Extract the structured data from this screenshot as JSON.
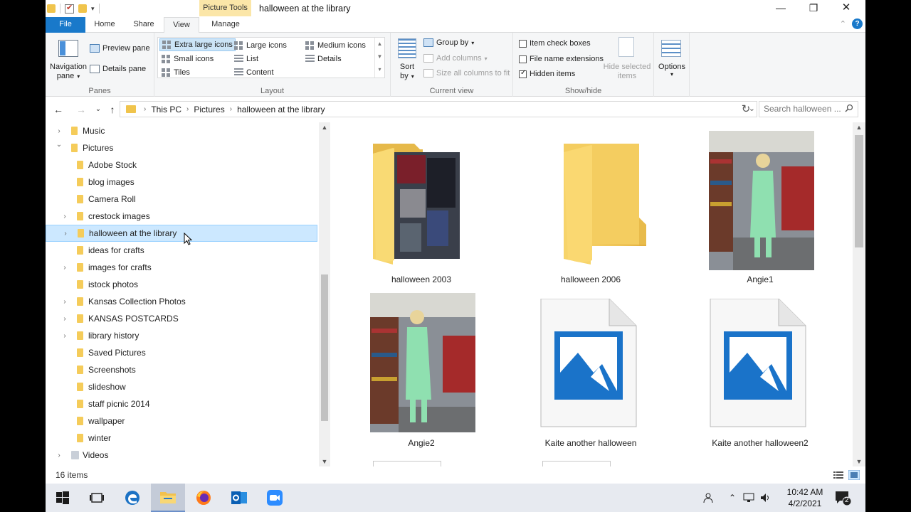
{
  "window": {
    "picture_tools": "Picture Tools",
    "title": "halloween at the library",
    "controls": {
      "minimize": "—",
      "maximize": "❐",
      "close": "✕"
    }
  },
  "tabs": {
    "file": "File",
    "home": "Home",
    "share": "Share",
    "view": "View",
    "manage": "Manage"
  },
  "ribbon": {
    "panes": {
      "label": "Panes",
      "navigation_pane": "Navigation",
      "navigation_pane2": "pane",
      "preview_pane": "Preview pane",
      "details_pane": "Details pane"
    },
    "layout": {
      "label": "Layout",
      "extra_large_icons": "Extra large icons",
      "large_icons": "Large icons",
      "medium_icons": "Medium icons",
      "small_icons": "Small icons",
      "list": "List",
      "details": "Details",
      "tiles": "Tiles",
      "content": "Content"
    },
    "current_view": {
      "label": "Current view",
      "sort_by": "Sort",
      "sort_by2": "by",
      "group_by": "Group by",
      "add_columns": "Add columns",
      "size_all_columns": "Size all columns to fit"
    },
    "show_hide": {
      "label": "Show/hide",
      "item_check_boxes": "Item check boxes",
      "file_name_extensions": "File name extensions",
      "hidden_items": "Hidden items",
      "hide_selected_items": "Hide selected",
      "hide_selected_items2": "items",
      "item_check_boxes_checked": false,
      "file_name_extensions_checked": false,
      "hidden_items_checked": true
    },
    "options": "Options"
  },
  "address": {
    "crumbs": [
      "This PC",
      "Pictures",
      "halloween at the library"
    ],
    "search_placeholder": "Search halloween ..."
  },
  "tree": [
    {
      "label": "Music",
      "level": 0,
      "expandable": true,
      "expanded": false,
      "icon": "music-icon"
    },
    {
      "label": "Pictures",
      "level": 0,
      "expandable": true,
      "expanded": true,
      "icon": "pictures-icon"
    },
    {
      "label": "Adobe Stock",
      "level": 1,
      "expandable": false
    },
    {
      "label": "blog images",
      "level": 1,
      "expandable": false
    },
    {
      "label": "Camera Roll",
      "level": 1,
      "expandable": false
    },
    {
      "label": "crestock images",
      "level": 1,
      "expandable": true
    },
    {
      "label": "halloween at the library",
      "level": 1,
      "expandable": true,
      "selected": true
    },
    {
      "label": "ideas for crafts",
      "level": 1,
      "expandable": false
    },
    {
      "label": "images for crafts",
      "level": 1,
      "expandable": true
    },
    {
      "label": "istock photos",
      "level": 1,
      "expandable": false
    },
    {
      "label": "Kansas Collection Photos",
      "level": 1,
      "expandable": true
    },
    {
      "label": "KANSAS POSTCARDS",
      "level": 1,
      "expandable": true
    },
    {
      "label": "library history",
      "level": 1,
      "expandable": true
    },
    {
      "label": "Saved Pictures",
      "level": 1,
      "expandable": false
    },
    {
      "label": "Screenshots",
      "level": 1,
      "expandable": false
    },
    {
      "label": "slideshow",
      "level": 1,
      "expandable": false
    },
    {
      "label": "staff picnic 2014",
      "level": 1,
      "expandable": false
    },
    {
      "label": "wallpaper",
      "level": 1,
      "expandable": false
    },
    {
      "label": "winter",
      "level": 1,
      "expandable": false
    },
    {
      "label": "Videos",
      "level": 0,
      "expandable": true,
      "expanded": false,
      "icon": "videos-icon"
    }
  ],
  "items": [
    {
      "name": "halloween 2003",
      "kind": "folder-with-photo"
    },
    {
      "name": "halloween 2006",
      "kind": "folder"
    },
    {
      "name": "Angie1",
      "kind": "photo"
    },
    {
      "name": "Angie2",
      "kind": "photo"
    },
    {
      "name": "Kaite another halloween",
      "kind": "image-file"
    },
    {
      "name": "Kaite another halloween2",
      "kind": "image-file"
    }
  ],
  "status": {
    "count": "16 items"
  },
  "taskbar": {
    "time": "10:42 AM",
    "date": "4/2/2021",
    "notification_count": "2",
    "apps": [
      "start-icon",
      "task-view-icon",
      "edge-icon",
      "file-explorer-icon",
      "firefox-icon",
      "outlook-icon",
      "zoom-icon"
    ]
  },
  "colors": {
    "accent": "#1979ca",
    "folder": "#f5cc5a",
    "selection": "#cce8ff",
    "taskbar": "#e7eaf0"
  }
}
